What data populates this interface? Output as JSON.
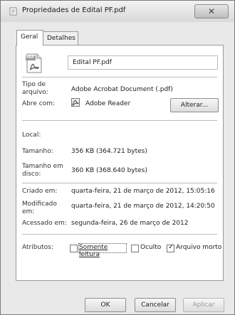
{
  "window": {
    "title": "Propriedades de Edital PF.pdf",
    "close_glyph": "✕"
  },
  "tabs": [
    {
      "label": "Geral",
      "active": true
    },
    {
      "label": "Detalhes",
      "active": false
    }
  ],
  "general": {
    "file_icon_text": "PDF",
    "filename": "Edital PF.pdf",
    "type_label": "Tipo de\narquivo:",
    "type_value": "Adobe Acrobat Document (.pdf)",
    "opens_with_label": "Abre com:",
    "opens_with_value": "Adobe Reader",
    "change_button": "Alterar...",
    "location_label": "Local:",
    "size_label": "Tamanho:",
    "size_value": "356 KB (364.721 bytes)",
    "size_on_disk_label": "Tamanho em\ndisco:",
    "size_on_disk_value": "360 KB (368.640 bytes)",
    "created_label": "Criado em:",
    "created_value": "quarta-feira, 21 de março de 2012, 15:05:16",
    "modified_label": "Modificado\nem:",
    "modified_value": "quarta-feira, 21 de março de 2012, 14:20:50",
    "accessed_label": "Acessado em:",
    "accessed_value": "segunda-feira, 26 de março de 2012",
    "attributes_label": "Atributos:",
    "readonly_label": "Somente leitura",
    "hidden_label": "Oculto",
    "archive_label": "Arquivo morto"
  },
  "attributes_state": {
    "readonly": false,
    "hidden": false,
    "archive": true
  },
  "buttons": {
    "ok": "OK",
    "cancel": "Cancelar",
    "apply": "Aplicar"
  },
  "icons": {
    "title": "file-properties-icon",
    "file": "pdf-file-icon",
    "reader": "adobe-reader-icon"
  }
}
